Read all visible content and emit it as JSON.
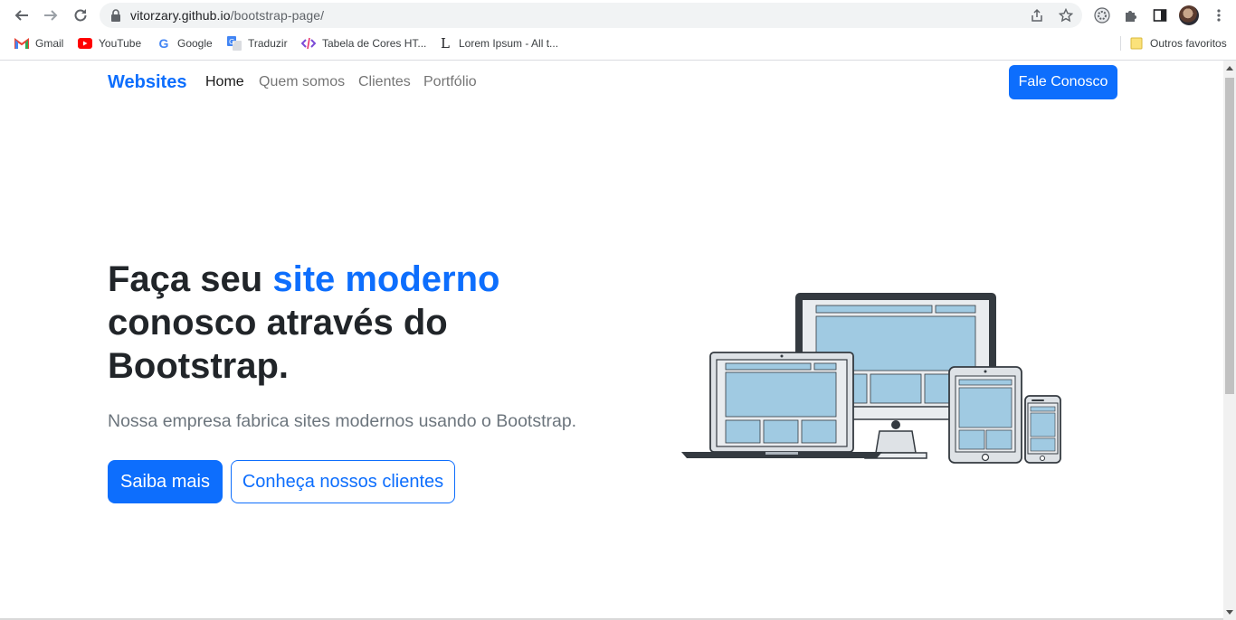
{
  "browser": {
    "url_host": "vitorzary.github.io",
    "url_path": "/bootstrap-page/",
    "bookmarks": [
      {
        "label": "Gmail",
        "icon": "gmail-icon"
      },
      {
        "label": "YouTube",
        "icon": "youtube-icon"
      },
      {
        "label": "Google",
        "icon": "google-icon"
      },
      {
        "label": "Traduzir",
        "icon": "translate-icon"
      },
      {
        "label": "Tabela de Cores HT...",
        "icon": "code-icon"
      },
      {
        "label": "Lorem Ipsum - All t...",
        "icon": "lorem-icon"
      }
    ],
    "other_bookmarks": "Outros favoritos"
  },
  "navbar": {
    "brand": "Websites",
    "links": [
      {
        "label": "Home",
        "active": true
      },
      {
        "label": "Quem somos",
        "active": false
      },
      {
        "label": "Clientes",
        "active": false
      },
      {
        "label": "Portfólio",
        "active": false
      }
    ],
    "cta": "Fale Conosco"
  },
  "hero": {
    "title_part1": "Faça seu ",
    "title_accent": "site moderno",
    "title_part2": "conosco através do Bootstrap.",
    "lead": "Nossa empresa fabrica sites modernos usando o Bootstrap.",
    "primary_button": "Saiba mais",
    "secondary_button": "Conheça nossos clientes"
  },
  "colors": {
    "primary": "#0d6efd",
    "text": "#212529",
    "muted": "#6c757d",
    "screen_blue": "#a0cae2"
  }
}
